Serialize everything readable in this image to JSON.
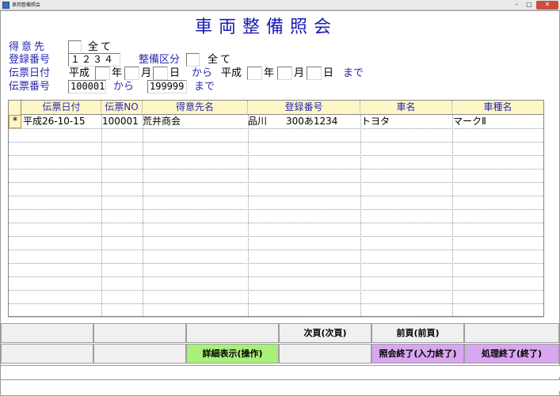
{
  "window": {
    "title": "車両整備照会"
  },
  "form": {
    "title": "車両整備照会",
    "fields": {
      "tokuisaki_label": "得意先",
      "tokuisaki_value": "",
      "tokuisaki_all": "全て",
      "touroku_label": "登録番号",
      "touroku_value": "１２３４",
      "seibi_label": "整備区分",
      "seibi_value": "",
      "seibi_all": "全て",
      "denpyo_date_label": "伝票日付",
      "era_from": "平成",
      "year_from": "",
      "year_unit": "年",
      "month_from": "",
      "month_unit": "月",
      "day_from": "",
      "day_unit": "日",
      "kara": "から",
      "era_to": "平成",
      "year_to": "",
      "month_to": "",
      "day_to": "",
      "made": "まで",
      "denpyo_no_label": "伝票番号",
      "denpyo_no_from": "100001",
      "denpyo_no_to": "199999"
    }
  },
  "grid": {
    "headers": [
      "伝票日付",
      "伝票NO",
      "得意先名",
      "登録番号",
      "車名",
      "車種名"
    ],
    "row_marker": "*",
    "rows": [
      [
        "平成26-10-15",
        "100001",
        "荒井商会",
        "品川　　300あ1234",
        "トヨタ",
        "マークⅡ"
      ]
    ]
  },
  "buttons": {
    "row1": [
      "",
      "",
      "",
      "次頁(次頁)",
      "前頁(前頁)",
      ""
    ],
    "row2": [
      "",
      "",
      "詳細表示(操作)",
      "",
      "照会終了(入力終了)",
      "処理終了(終了)"
    ]
  },
  "colors": {
    "title": "#1a1ab3",
    "label": "#2a2ab0",
    "header_bg": "#fff6c8",
    "green_button": "#a9f07a",
    "purple_button": "#d9a6f0"
  }
}
